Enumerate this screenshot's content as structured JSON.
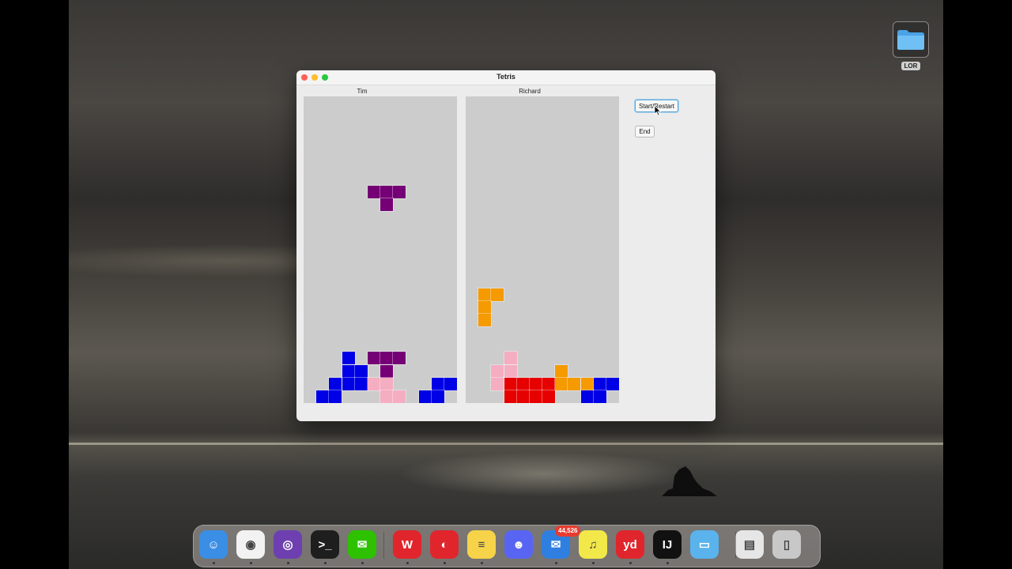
{
  "window": {
    "title": "Tetris"
  },
  "players": [
    {
      "name": "Tim"
    },
    {
      "name": "Richard"
    }
  ],
  "buttons": {
    "start": "Start/Restart",
    "end": "End"
  },
  "colors": {
    "purple": "#750075",
    "blue": "#0000e6",
    "pink": "#f5adc2",
    "orange": "#f59a00",
    "red": "#e60000"
  },
  "boards": [
    {
      "cols": 12,
      "rows": 24,
      "cells": [
        {
          "c": 5,
          "r": 7,
          "color": "purple"
        },
        {
          "c": 6,
          "r": 7,
          "color": "purple"
        },
        {
          "c": 7,
          "r": 7,
          "color": "purple"
        },
        {
          "c": 6,
          "r": 8,
          "color": "purple"
        },
        {
          "c": 3,
          "r": 20,
          "color": "blue"
        },
        {
          "c": 5,
          "r": 20,
          "color": "purple"
        },
        {
          "c": 6,
          "r": 20,
          "color": "purple"
        },
        {
          "c": 7,
          "r": 20,
          "color": "purple"
        },
        {
          "c": 3,
          "r": 21,
          "color": "blue"
        },
        {
          "c": 4,
          "r": 21,
          "color": "blue"
        },
        {
          "c": 6,
          "r": 21,
          "color": "purple"
        },
        {
          "c": 2,
          "r": 22,
          "color": "blue"
        },
        {
          "c": 3,
          "r": 22,
          "color": "blue"
        },
        {
          "c": 4,
          "r": 22,
          "color": "blue"
        },
        {
          "c": 5,
          "r": 22,
          "color": "pink"
        },
        {
          "c": 6,
          "r": 22,
          "color": "pink"
        },
        {
          "c": 10,
          "r": 22,
          "color": "blue"
        },
        {
          "c": 11,
          "r": 22,
          "color": "blue"
        },
        {
          "c": 1,
          "r": 23,
          "color": "blue"
        },
        {
          "c": 2,
          "r": 23,
          "color": "blue"
        },
        {
          "c": 6,
          "r": 23,
          "color": "pink"
        },
        {
          "c": 7,
          "r": 23,
          "color": "pink"
        },
        {
          "c": 9,
          "r": 23,
          "color": "blue"
        },
        {
          "c": 10,
          "r": 23,
          "color": "blue"
        }
      ]
    },
    {
      "cols": 12,
      "rows": 24,
      "cells": [
        {
          "c": 1,
          "r": 15,
          "color": "orange"
        },
        {
          "c": 2,
          "r": 15,
          "color": "orange"
        },
        {
          "c": 1,
          "r": 16,
          "color": "orange"
        },
        {
          "c": 1,
          "r": 17,
          "color": "orange"
        },
        {
          "c": 3,
          "r": 20,
          "color": "pink"
        },
        {
          "c": 2,
          "r": 21,
          "color": "pink"
        },
        {
          "c": 3,
          "r": 21,
          "color": "pink"
        },
        {
          "c": 7,
          "r": 21,
          "color": "orange"
        },
        {
          "c": 2,
          "r": 22,
          "color": "pink"
        },
        {
          "c": 3,
          "r": 22,
          "color": "red"
        },
        {
          "c": 4,
          "r": 22,
          "color": "red"
        },
        {
          "c": 5,
          "r": 22,
          "color": "red"
        },
        {
          "c": 6,
          "r": 22,
          "color": "red"
        },
        {
          "c": 7,
          "r": 22,
          "color": "orange"
        },
        {
          "c": 8,
          "r": 22,
          "color": "orange"
        },
        {
          "c": 9,
          "r": 22,
          "color": "orange"
        },
        {
          "c": 10,
          "r": 22,
          "color": "blue"
        },
        {
          "c": 11,
          "r": 22,
          "color": "blue"
        },
        {
          "c": 3,
          "r": 23,
          "color": "red"
        },
        {
          "c": 4,
          "r": 23,
          "color": "red"
        },
        {
          "c": 5,
          "r": 23,
          "color": "red"
        },
        {
          "c": 6,
          "r": 23,
          "color": "red"
        },
        {
          "c": 9,
          "r": 23,
          "color": "blue"
        },
        {
          "c": 10,
          "r": 23,
          "color": "blue"
        }
      ]
    }
  ],
  "desktop": {
    "folder_label": "LOR"
  },
  "dock": {
    "mail_badge": "44,526",
    "apps": [
      {
        "name": "finder-icon",
        "bg": "#3a8ee6",
        "glyph": "☺",
        "running": true
      },
      {
        "name": "chrome-icon",
        "bg": "#f2f2f2",
        "glyph": "◉",
        "running": true
      },
      {
        "name": "github-desktop-icon",
        "bg": "#6e3fb0",
        "glyph": "◎",
        "running": true
      },
      {
        "name": "terminal-icon",
        "bg": "#1e1e1e",
        "glyph": ">_",
        "running": true
      },
      {
        "name": "wechat-icon",
        "bg": "#2dc100",
        "glyph": "✉",
        "running": true
      },
      {
        "name": "wps-office-icon",
        "bg": "#e0262c",
        "glyph": "W",
        "running": true
      },
      {
        "name": "netease-music-icon",
        "bg": "#e0262c",
        "glyph": "◐",
        "running": true
      },
      {
        "name": "notes-icon",
        "bg": "#f7d34a",
        "glyph": "≡",
        "running": true
      },
      {
        "name": "discord-icon",
        "bg": "#5865f2",
        "glyph": "☻",
        "running": false
      },
      {
        "name": "mail-icon",
        "bg": "#2f7fe0",
        "glyph": "✉",
        "running": true
      },
      {
        "name": "qq-music-icon",
        "bg": "#f2e84a",
        "glyph": "♫",
        "running": true
      },
      {
        "name": "youdao-icon",
        "bg": "#e0262c",
        "glyph": "yd",
        "running": true
      },
      {
        "name": "intellij-icon",
        "bg": "#111111",
        "glyph": "IJ",
        "running": true
      },
      {
        "name": "folder-icon",
        "bg": "#5ab3ec",
        "glyph": "▭",
        "running": false
      },
      {
        "name": "preview-icon",
        "bg": "#e6e6e6",
        "glyph": "▤",
        "running": false
      },
      {
        "name": "trash-icon",
        "bg": "#c8c8c8",
        "glyph": "▯",
        "running": false
      }
    ]
  }
}
